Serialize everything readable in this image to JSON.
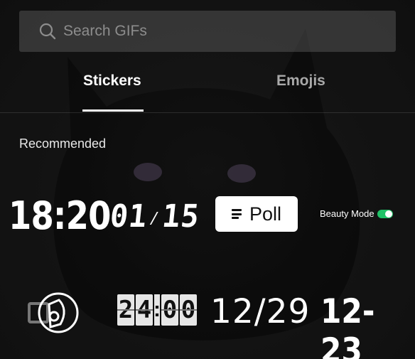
{
  "search": {
    "placeholder": "Search GIFs",
    "icon": "search-icon"
  },
  "tabs": [
    {
      "label": "Stickers",
      "active": true
    },
    {
      "label": "Emojis",
      "active": false
    }
  ],
  "section": {
    "label": "Recommended"
  },
  "stickers": {
    "row1": {
      "clock_time": "18:20",
      "date_month": "01",
      "date_sep": "/",
      "date_day": "15",
      "poll_label": "Poll",
      "beauty_label": "Beauty Mode",
      "beauty_on": true
    },
    "row2": {
      "flip_digits": [
        "2",
        "4",
        "0",
        "0"
      ],
      "flip_colon": ":",
      "date_a": "12/29",
      "date_b": "12-23"
    }
  },
  "colors": {
    "toggle_on": "#20c267",
    "accent_white": "#ffffff",
    "muted_tab": "#a9a9a9"
  }
}
